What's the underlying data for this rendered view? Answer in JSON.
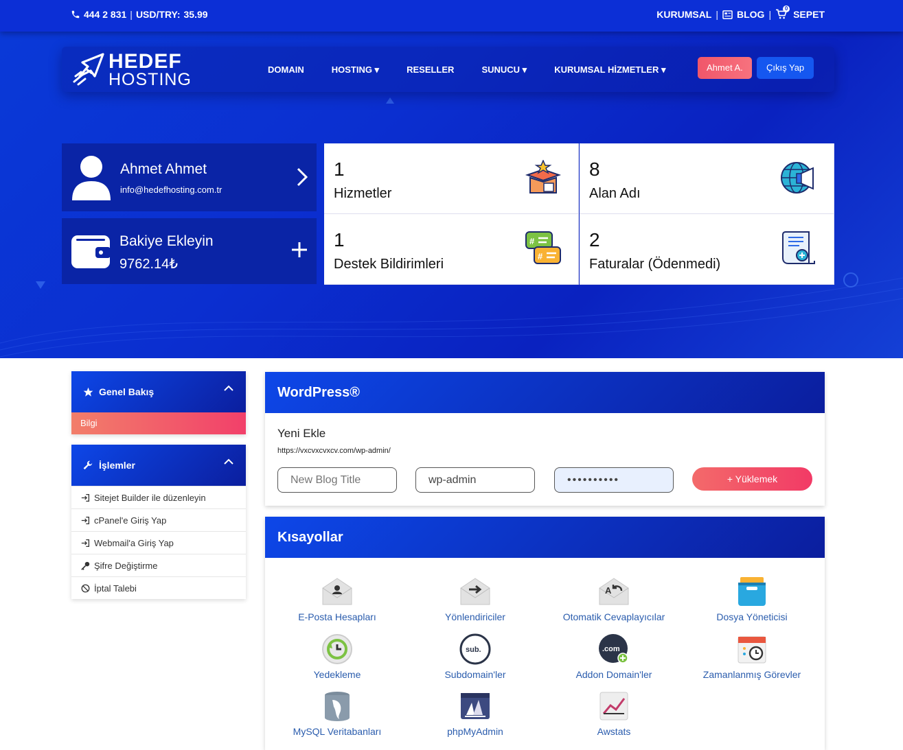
{
  "topbar": {
    "phone": "444 2 831",
    "currency_label": "USD/TRY:",
    "currency_value": "35.99",
    "links": [
      "KURUMSAL",
      "BLOG",
      "SEPET"
    ],
    "cart_count": "0"
  },
  "brand": {
    "line1": "HEDEF",
    "line2": "HOSTING"
  },
  "nav": {
    "items": [
      "DOMAIN",
      "HOSTING ▾",
      "RESELLER",
      "SUNUCU ▾",
      "KURUMSAL HİZMETLER ▾"
    ],
    "user_button": "Ahmet A.",
    "logout_button": "Çıkış Yap"
  },
  "profile": {
    "name": "Ahmet Ahmet",
    "email": "info@hedefhosting.com.tr"
  },
  "wallet": {
    "title": "Bakiye Ekleyin",
    "balance": "9762.14₺"
  },
  "stats": [
    {
      "count": "1",
      "label": "Hizmetler",
      "icon": "box-star-icon"
    },
    {
      "count": "8",
      "label": "Alan Adı",
      "icon": "globe-megaphone-icon"
    },
    {
      "count": "1",
      "label": "Destek Bildirimleri",
      "icon": "chat-bubbles-icon"
    },
    {
      "count": "2",
      "label": "Faturalar (Ödenmedi)",
      "icon": "invoice-icon"
    }
  ],
  "sidebar": {
    "overview": {
      "title": "Genel Bakış",
      "active_item": "Bilgi"
    },
    "actions": {
      "title": "İşlemler",
      "items": [
        "Sitejet Builder ile düzenleyin",
        "cPanel'e Giriş Yap",
        "Webmail'a Giriş Yap",
        "Şifre Değiştirme",
        "İptal Talebi"
      ]
    }
  },
  "wordpress": {
    "title": "WordPress®",
    "subtitle": "Yeni Ekle",
    "url": "https://vxcvxcvxcv.com/wp-admin/",
    "blog_title_placeholder": "New Blog Title",
    "path_value": "wp-admin",
    "password_value": "••••••••••",
    "install_button": "+ Yüklemek"
  },
  "shortcuts": {
    "title": "Kısayollar",
    "items": [
      "E-Posta Hesapları",
      "Yönlendiriciler",
      "Otomatik Cevaplayıcılar",
      "Dosya Yöneticisi",
      "Yedekleme",
      "Subdomain'ler",
      "Addon Domain'ler",
      "Zamanlanmış Görevler",
      "MySQL Veritabanları",
      "phpMyAdmin",
      "Awstats"
    ]
  },
  "colors": {
    "primary": "#0b2fd0",
    "accent": "#f0566a",
    "link": "#2a5cad"
  }
}
